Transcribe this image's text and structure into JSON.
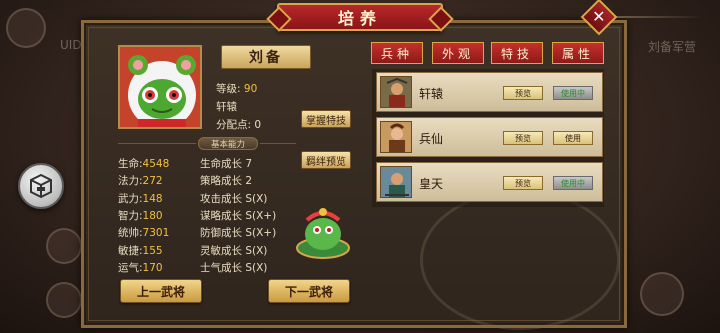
{
  "window": {
    "title": "培养",
    "close_icon": "close-icon"
  },
  "background": {
    "left_label": "UID_",
    "right_label": "刘备军营"
  },
  "hero": {
    "name": "刘备",
    "level_label": "等级:",
    "level_value": "90",
    "mount_name": "轩辕",
    "points_label": "分配点:",
    "points_value": "0"
  },
  "buttons": {
    "master_skill": "掌握特技",
    "bond_preview": "羁绊预览",
    "prev_general": "上一武将",
    "next_general": "下一武将"
  },
  "section": {
    "basic_ability": "基本能力"
  },
  "stats": [
    {
      "label": "生命:",
      "value": "4548"
    },
    {
      "label": "法力:",
      "value": "272"
    },
    {
      "label": "武力:",
      "value": "148"
    },
    {
      "label": "智力:",
      "value": "180"
    },
    {
      "label": "统帅:",
      "value": "7301"
    },
    {
      "label": "敏捷:",
      "value": "155"
    },
    {
      "label": "运气:",
      "value": "170"
    }
  ],
  "growth": [
    {
      "label": "生命成长",
      "value": "7"
    },
    {
      "label": "策略成长",
      "value": "2"
    },
    {
      "label": "攻击成长",
      "value": "S(X)"
    },
    {
      "label": "谋略成长",
      "value": "S(X+)"
    },
    {
      "label": "防御成长",
      "value": "S(X+)"
    },
    {
      "label": "灵敏成长",
      "value": "S(X)"
    },
    {
      "label": "士气成长",
      "value": "S(X)"
    }
  ],
  "tabs": [
    {
      "label": "兵种"
    },
    {
      "label": "外观"
    },
    {
      "label": "特技"
    },
    {
      "label": "属性"
    }
  ],
  "troops": [
    {
      "name": "轩辕",
      "preview": "预览",
      "use": "使用中",
      "state": "active"
    },
    {
      "name": "兵仙",
      "preview": "预览",
      "use": "使用",
      "state": "idle"
    },
    {
      "name": "皇天",
      "preview": "预览",
      "use": "使用中",
      "state": "active"
    }
  ],
  "colors": {
    "accent_red": "#b8282a",
    "gold_text": "#f0c040",
    "frame_gold": "#d9a64a"
  }
}
